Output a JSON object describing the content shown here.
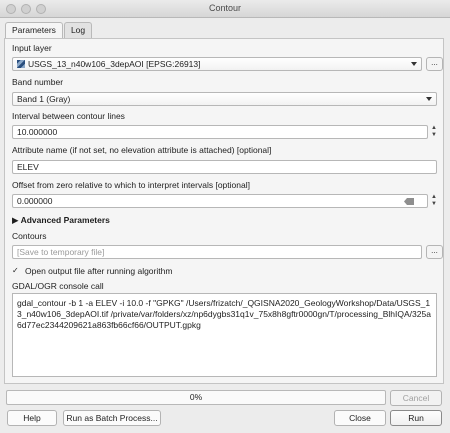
{
  "window": {
    "title": "Contour"
  },
  "tabs": [
    {
      "label": "Parameters"
    },
    {
      "label": "Log"
    }
  ],
  "params": {
    "input_layer": {
      "label": "Input layer",
      "value": "USGS_13_n40w106_3depAOI [EPSG:26913]",
      "browse_label": "..."
    },
    "band": {
      "label": "Band number",
      "value": "Band 1 (Gray)"
    },
    "interval": {
      "label": "Interval between contour lines",
      "value": "10.000000"
    },
    "attribute": {
      "label": "Attribute name (if not set, no elevation attribute is attached) [optional]",
      "value": "ELEV"
    },
    "offset": {
      "label": "Offset from zero relative to which to interpret intervals [optional]",
      "value": "0.000000"
    },
    "advanced": {
      "label": "Advanced Parameters"
    },
    "contours": {
      "label": "Contours",
      "placeholder": "[Save to temporary file]",
      "browse_label": "..."
    },
    "open_output": {
      "label": "Open output file after running algorithm",
      "checked": true
    },
    "console": {
      "label": "GDAL/OGR console call",
      "text": "gdal_contour -b 1 -a ELEV -i 10.0 -f \"GPKG\" /Users/frizatch/_QGISNA2020_GeologyWorkshop/Data/USGS_13_n40w106_3depAOI.tif /private/var/folders/xz/np6dygbs31q1v_75x8h8gftr0000gn/T/processing_BlhIQA/325a6d77ec2344209621a863fb66cf66/OUTPUT.gpkg"
    }
  },
  "progress": {
    "value": 0,
    "text": "0%"
  },
  "buttons": {
    "cancel": "Cancel",
    "help": "Help",
    "batch": "Run as Batch Process...",
    "close": "Close",
    "run": "Run"
  }
}
